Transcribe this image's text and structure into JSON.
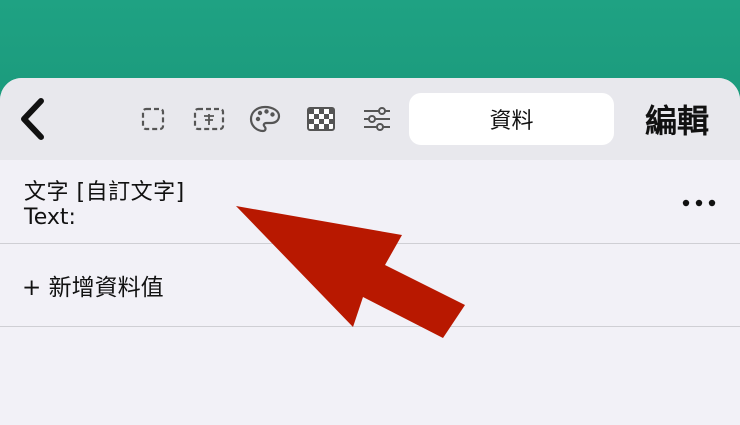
{
  "toolbar": {
    "icons": [
      "selection-icon",
      "text-field-icon",
      "palette-icon",
      "checkerboard-icon",
      "sliders-icon"
    ],
    "segment_label": "資料",
    "edit_label": "編輯"
  },
  "attribute": {
    "title": "文字 [自訂文字]",
    "value": "Text:"
  },
  "actions": {
    "add_label": "+ 新增資料值"
  },
  "colors": {
    "background": "#1f9e80",
    "sheet": "#f2f1f7",
    "toolbar": "#e8e8ed",
    "arrow": "#b81800"
  }
}
